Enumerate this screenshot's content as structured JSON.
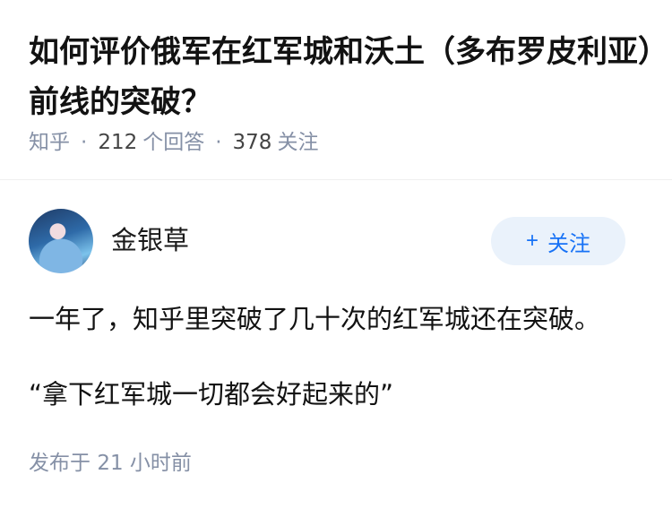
{
  "question": {
    "title": "如何评价俄军在红军城和沃土（多布罗皮利亚）前线的突破？",
    "source": "知乎",
    "answer_count": "212",
    "answer_label": "个回答",
    "follower_count": "378",
    "follower_label": "关注"
  },
  "answer": {
    "author_name": "金银草",
    "follow_label": "关注",
    "follow_icon": "plus-icon",
    "paragraphs": [
      "一年了，知乎里突破了几十次的红军城还在突破。",
      "“拿下红军城一切都会好起来的”"
    ],
    "published_label": "发布于",
    "published_time": "21 小时前"
  }
}
